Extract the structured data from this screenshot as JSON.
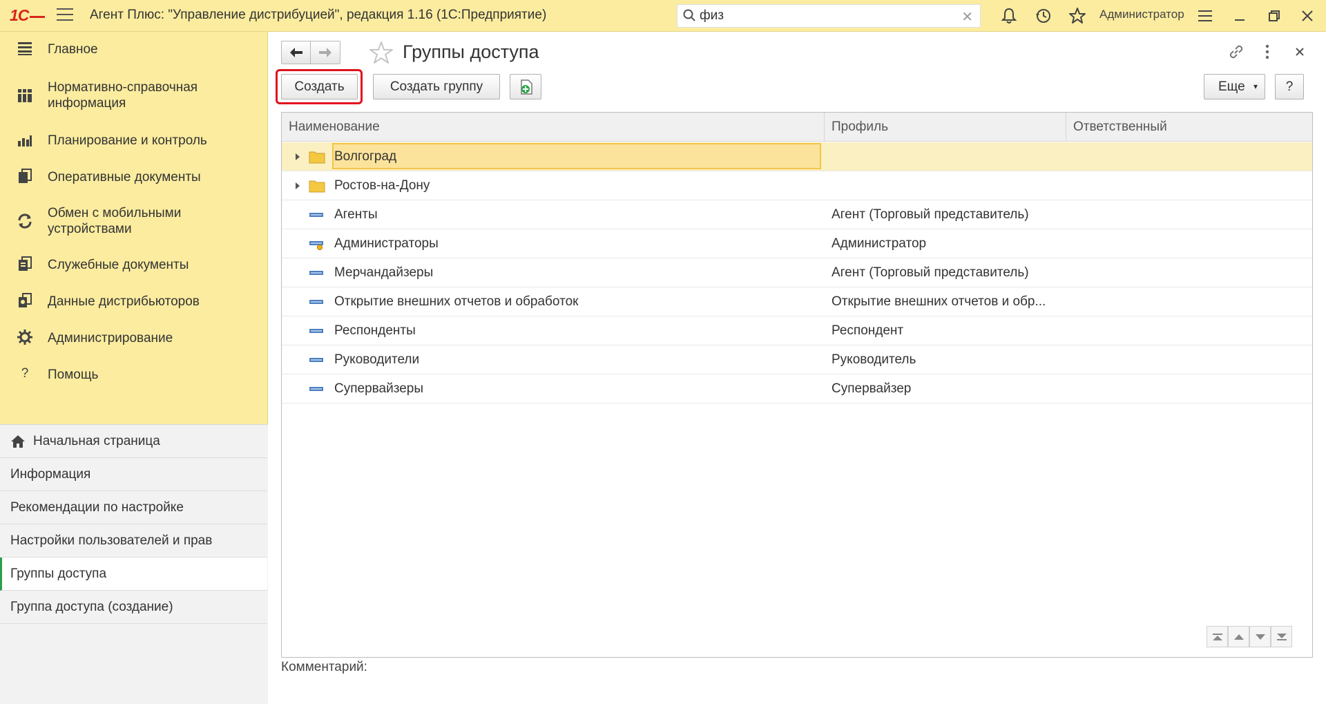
{
  "titlebar": {
    "logo_text": "1С",
    "title": "Агент Плюс: \"Управление дистрибуцией\", редакция 1.16  (1С:Предприятие)",
    "search_value": "физ",
    "user": "Администратор",
    "icons": [
      "menu-icon",
      "search-icon",
      "clear-icon",
      "bell-icon",
      "history-icon",
      "star-icon",
      "settings-list-icon",
      "minimize-icon",
      "restore-icon",
      "close-icon"
    ]
  },
  "sidebar": {
    "sections": [
      {
        "label": "Главное",
        "icon": "list-icon"
      },
      {
        "label": "Нормативно-справочная информация",
        "icon": "catalog-icon"
      },
      {
        "label": "Планирование и контроль",
        "icon": "chart-icon"
      },
      {
        "label": "Оперативные документы",
        "icon": "documents-icon"
      },
      {
        "label": "Обмен с мобильными устройствами",
        "icon": "sync-icon"
      },
      {
        "label": "Служебные документы",
        "icon": "service-docs-icon"
      },
      {
        "label": "Данные дистрибьюторов",
        "icon": "distributor-icon"
      },
      {
        "label": "Администрирование",
        "icon": "gear-icon"
      },
      {
        "label": "Помощь",
        "icon": "help-icon"
      }
    ],
    "open_items": [
      {
        "label": "Начальная страница",
        "icon": "home-icon"
      },
      {
        "label": "Информация"
      },
      {
        "label": "Рекомендации по настройке"
      },
      {
        "label": "Настройки пользователей и прав"
      },
      {
        "label": "Группы доступа"
      },
      {
        "label": "Группа доступа (создание)"
      }
    ]
  },
  "main": {
    "title": "Группы доступа",
    "buttons": {
      "create": "Создать",
      "create_group": "Создать группу",
      "more": "Еще",
      "help": "?"
    },
    "table": {
      "columns": [
        "Наименование",
        "Профиль",
        "Ответственный"
      ],
      "rows": [
        {
          "name": "Волгоград",
          "profile": "",
          "responsible": "",
          "kind": "folder"
        },
        {
          "name": "Ростов-на-Дону",
          "profile": "",
          "responsible": "",
          "kind": "folder"
        },
        {
          "name": "Агенты",
          "profile": "Агент (Торговый представитель)",
          "responsible": "",
          "kind": "group"
        },
        {
          "name": "Администраторы",
          "profile": "Администратор",
          "responsible": "",
          "kind": "group-admin"
        },
        {
          "name": "Мерчандайзеры",
          "profile": "Агент (Торговый представитель)",
          "responsible": "",
          "kind": "group"
        },
        {
          "name": "Открытие внешних отчетов и обработок",
          "profile": "Открытие внешних отчетов и обр...",
          "responsible": "",
          "kind": "group"
        },
        {
          "name": "Респонденты",
          "profile": "Респондент",
          "responsible": "",
          "kind": "group"
        },
        {
          "name": "Руководители",
          "profile": "Руководитель",
          "responsible": "",
          "kind": "group"
        },
        {
          "name": "Супервайзеры",
          "profile": "Супервайзер",
          "responsible": "",
          "kind": "group"
        }
      ]
    },
    "comment_label": "Комментарий:"
  },
  "colors": {
    "panel_yellow": "#fbec9f",
    "selected_row": "#fbf0c2",
    "highlight_red": "#e0111e",
    "active_marker": "#2e9e4a",
    "group_icon": "#4d7fbf",
    "folder": "#f5c842"
  }
}
